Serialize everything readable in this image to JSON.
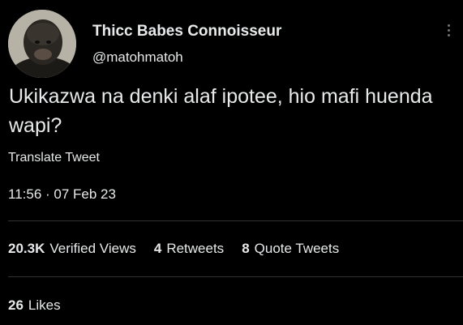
{
  "author": {
    "display_name": "Thicc Babes Connoisseur",
    "handle": "@matohmatoh"
  },
  "tweet": {
    "text": "Ukikazwa na denki alaf ipotee, hio mafi huenda wapi?",
    "translate_label": "Translate Tweet",
    "timestamp": "11:56 · 07 Feb 23"
  },
  "stats": {
    "views_count": "20.3K",
    "views_label": "Verified Views",
    "retweets_count": "4",
    "retweets_label": "Retweets",
    "quote_count": "8",
    "quote_label": "Quote Tweets",
    "likes_count": "26",
    "likes_label": "Likes"
  },
  "icons": {
    "more": "more-vertical-icon"
  },
  "colors": {
    "background": "#000000",
    "text": "#e7e9ea",
    "divider": "#2f3336",
    "muted": "#71767b"
  }
}
